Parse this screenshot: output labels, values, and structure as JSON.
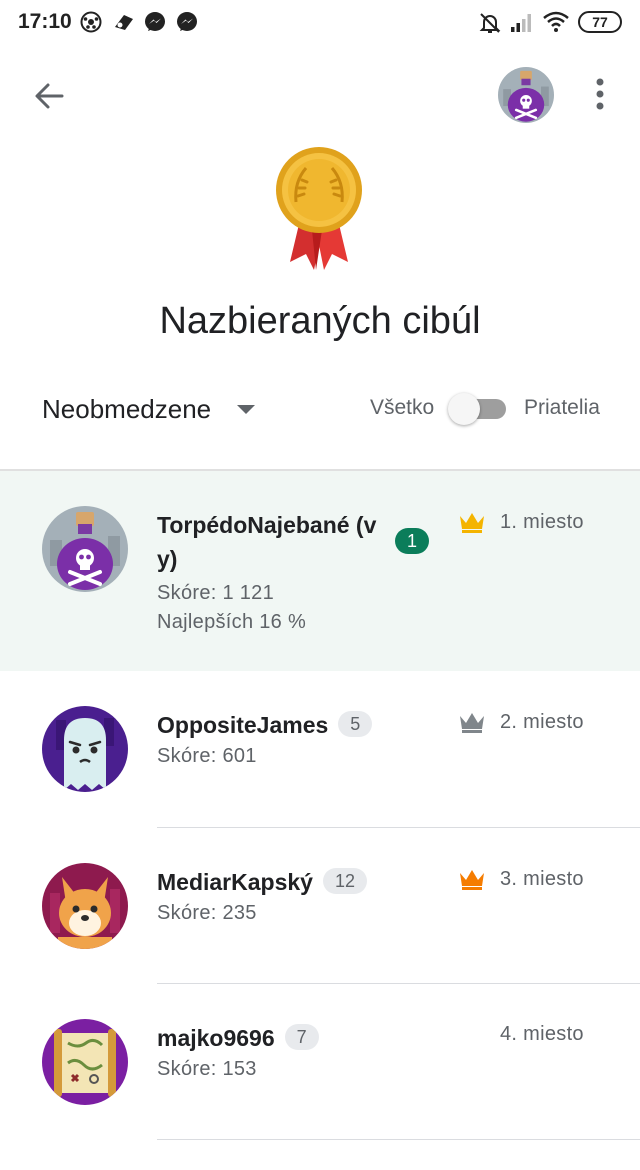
{
  "status_bar": {
    "time": "17:10",
    "battery": "77",
    "icons": [
      "soccer-icon",
      "app-icon",
      "messenger-icon",
      "messenger-icon",
      "mute-icon",
      "signal-icon",
      "wifi-icon",
      "battery-icon"
    ]
  },
  "app_bar": {
    "icons": [
      "back-arrow-icon",
      "profile-avatar",
      "more-vert-icon"
    ]
  },
  "title": "Nazbieraných cibúl",
  "filter": {
    "time_range": "Neobmedzene",
    "toggle_left": "Všetko",
    "toggle_right": "Priatelia",
    "toggle_on": false
  },
  "colors": {
    "highlight_row": "#f1f7f4",
    "rank_badge_self": "#0b7d5a",
    "crown_gold": "#f4b400",
    "crown_silver": "#80868b",
    "crown_bronze": "#f57c00"
  },
  "leaderboard": [
    {
      "name": "TorpédoNajebané (vy)",
      "name_line1": "TorpédoNajebané (v",
      "name_line2": "y)",
      "level": "1",
      "score": "Skóre: 1 121",
      "percentile": "Najlepších 16 %",
      "place": "1. miesto",
      "crown": "gold"
    },
    {
      "name": "OppositeJames",
      "level": "5",
      "score": "Skóre: 601",
      "place": "2. miesto",
      "crown": "silver"
    },
    {
      "name": "MediarKapský",
      "level": "12",
      "score": "Skóre: 235",
      "place": "3. miesto",
      "crown": "bronze"
    },
    {
      "name": "majko9696",
      "level": "7",
      "score": "Skóre: 153",
      "place": "4. miesto",
      "crown": "none"
    }
  ]
}
